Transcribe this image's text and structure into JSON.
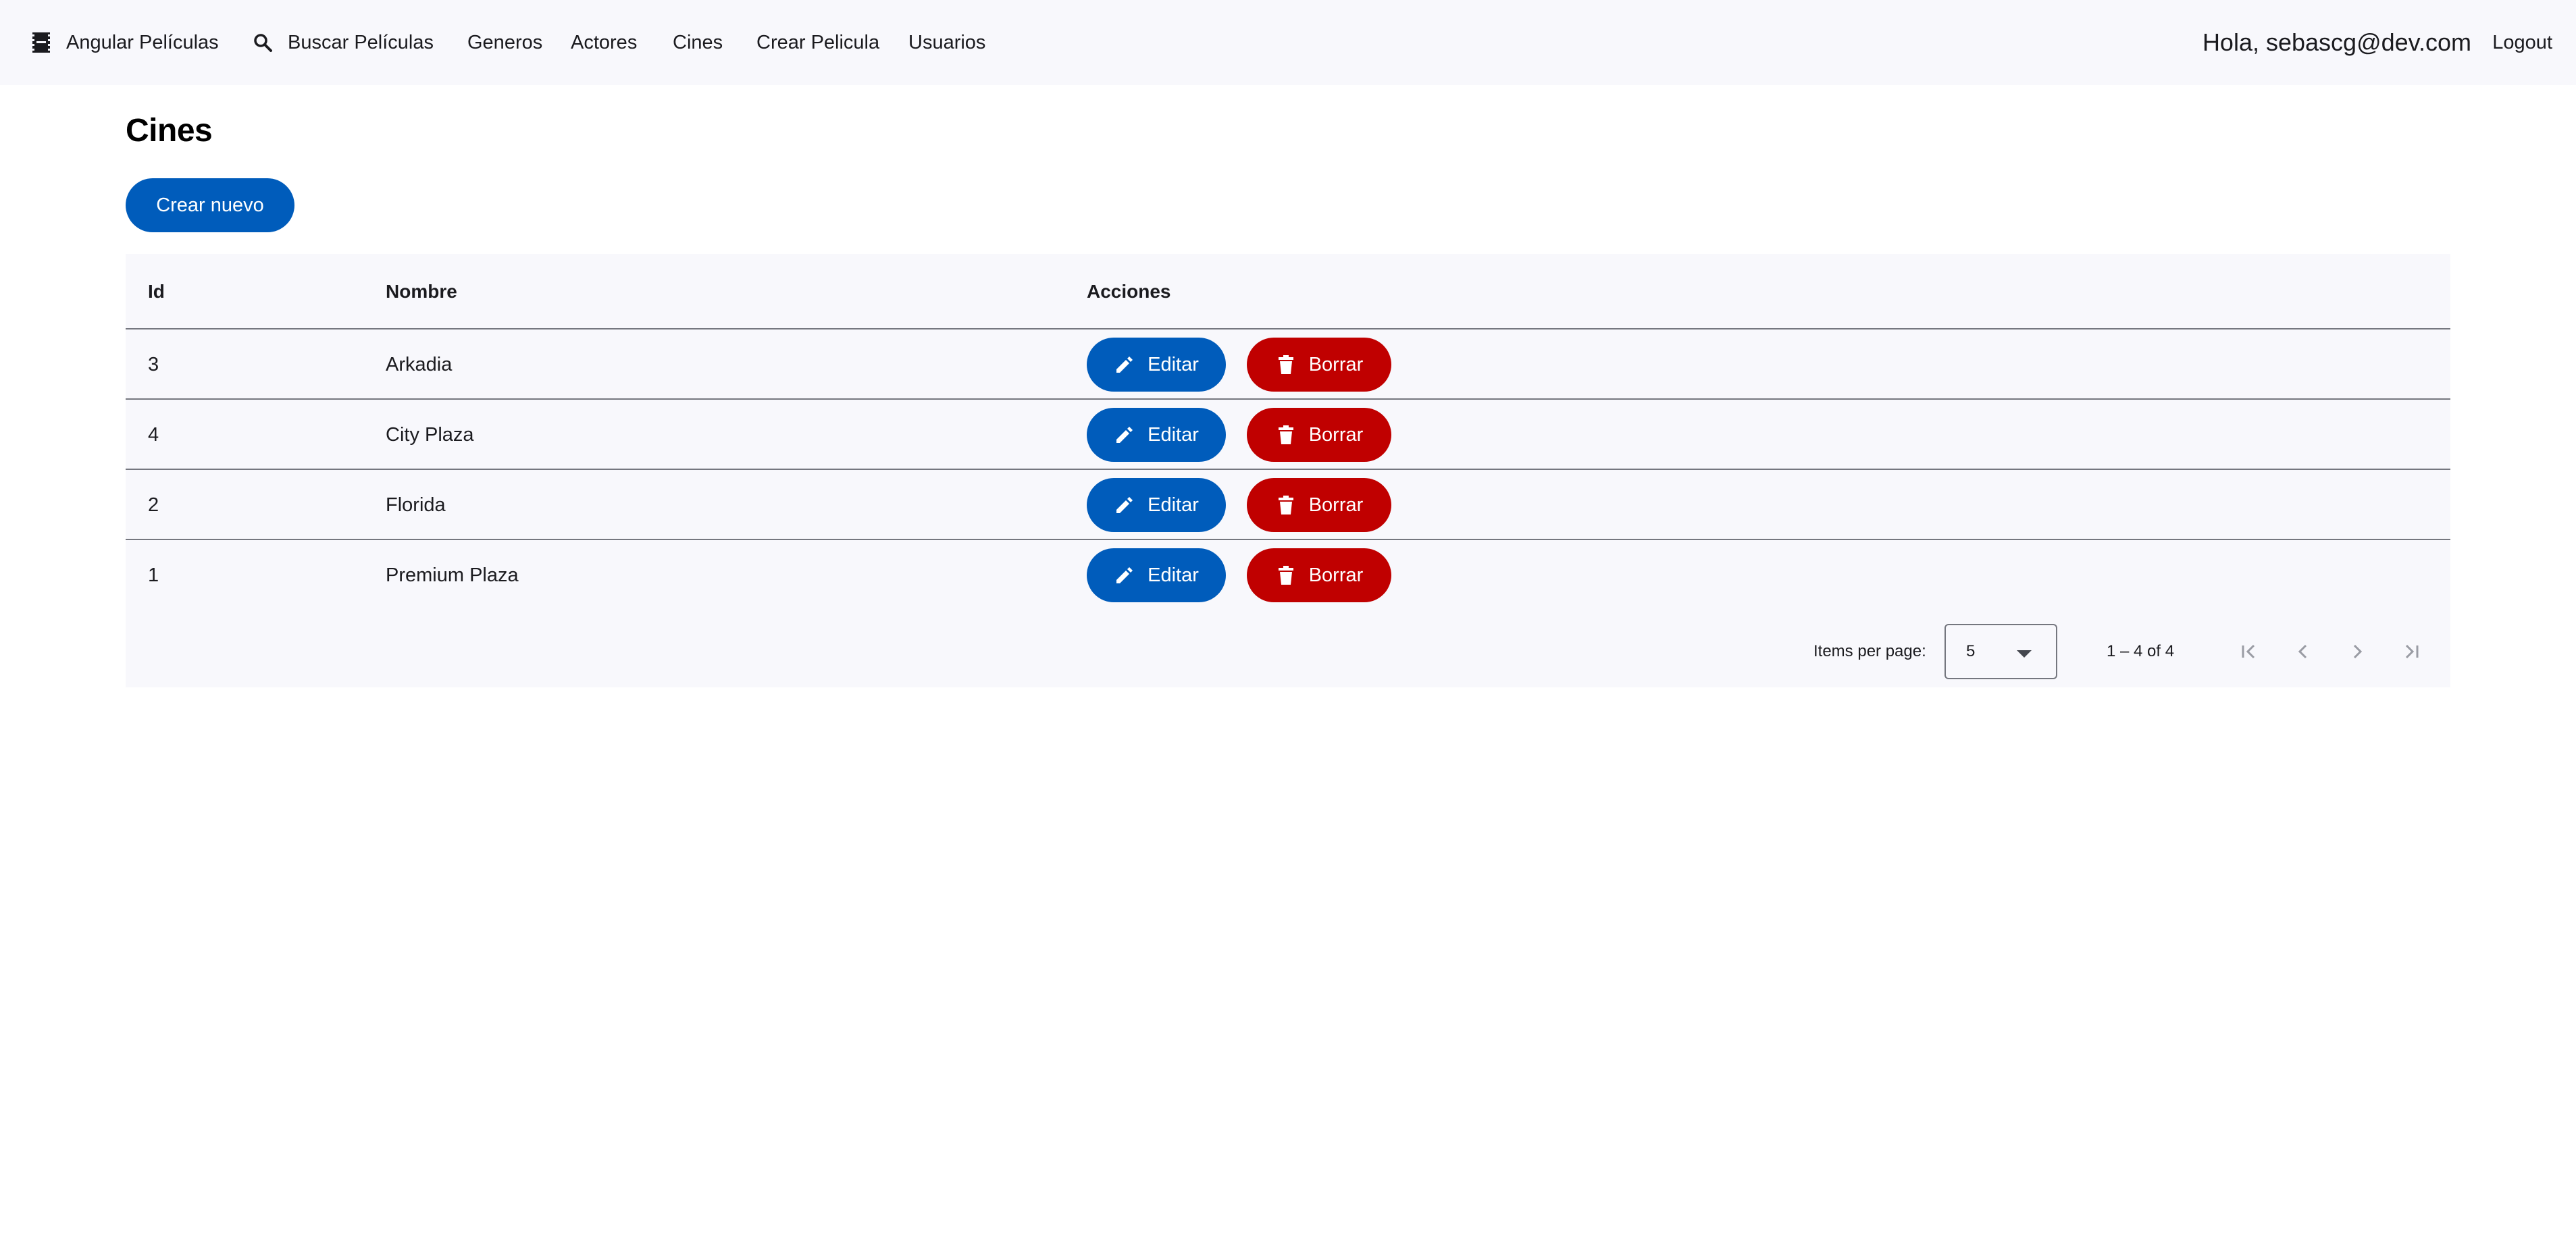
{
  "nav": {
    "brand": "Angular Películas",
    "search": "Buscar Películas",
    "generos": "Generos",
    "actores": "Actores",
    "cines": "Cines",
    "crear_pelicula": "Crear Pelicula",
    "usuarios": "Usuarios",
    "greeting": "Hola, sebascg@dev.com",
    "logout": "Logout"
  },
  "page": {
    "title": "Cines",
    "create_button": "Crear nuevo"
  },
  "table": {
    "columns": [
      "Id",
      "Nombre",
      "Acciones"
    ],
    "rows": [
      {
        "id": "3",
        "nombre": "Arkadia"
      },
      {
        "id": "4",
        "nombre": "City Plaza"
      },
      {
        "id": "2",
        "nombre": "Florida"
      },
      {
        "id": "1",
        "nombre": "Premium Plaza"
      }
    ],
    "edit_label": "Editar",
    "delete_label": "Borrar"
  },
  "paginator": {
    "items_per_page_label": "Items per page:",
    "page_size": "5",
    "range": "1 – 4 of 4"
  },
  "icons": {
    "brand": "movie-icon",
    "search": "search-icon",
    "edit": "pencil-icon",
    "delete": "trash-icon"
  },
  "colors": {
    "primary": "#005cbb",
    "danger": "#c00000",
    "surface": "#f8f8fc",
    "divider": "#75777f"
  }
}
